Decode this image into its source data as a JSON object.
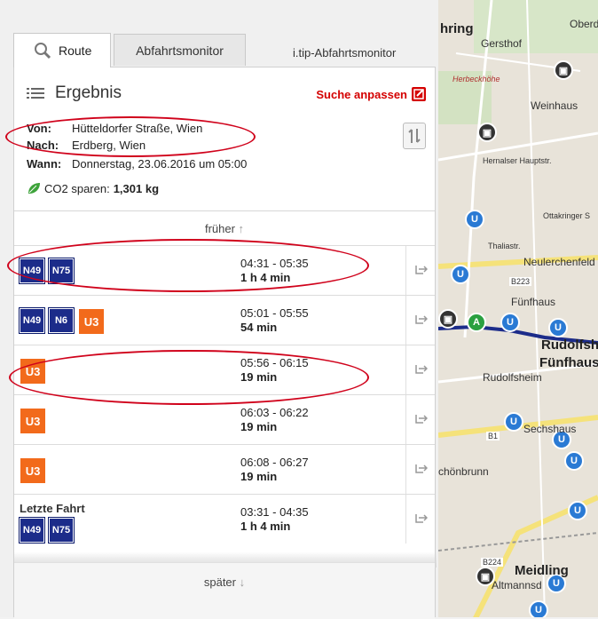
{
  "tabs": {
    "route": "Route",
    "monitor": "Abfahrtsmonitor",
    "itip": "i.tip-Abfahrtsmonitor"
  },
  "header": {
    "title": "Ergebnis",
    "edit_label": "Suche anpassen"
  },
  "trip": {
    "from_label": "Von:",
    "from_value": "Hütteldorfer Straße, Wien",
    "to_label": "Nach:",
    "to_value": "Erdberg, Wien",
    "when_label": "Wann:",
    "when_value": "Donnerstag, 23.06.2016 um 05:00",
    "co2_label": "CO2 sparen:",
    "co2_value": "1,301 kg"
  },
  "nav": {
    "earlier": "früher",
    "later": "später"
  },
  "connections": [
    {
      "lines": [
        "N49",
        "N75"
      ],
      "types": [
        "bus",
        "bus"
      ],
      "time": "04:31 - 05:35",
      "duration": "1 h 4 min"
    },
    {
      "lines": [
        "N49",
        "N6",
        "U3"
      ],
      "types": [
        "bus",
        "bus",
        "u"
      ],
      "time": "05:01 - 05:55",
      "duration": "54 min"
    },
    {
      "lines": [
        "U3"
      ],
      "types": [
        "u"
      ],
      "time": "05:56 - 06:15",
      "duration": "19 min"
    },
    {
      "lines": [
        "U3"
      ],
      "types": [
        "u"
      ],
      "time": "06:03 - 06:22",
      "duration": "19 min"
    },
    {
      "lines": [
        "U3"
      ],
      "types": [
        "u"
      ],
      "time": "06:08 - 06:27",
      "duration": "19 min"
    },
    {
      "lines": [
        "N49",
        "N75"
      ],
      "types": [
        "bus",
        "bus"
      ],
      "time": "03:31 - 04:35",
      "duration": "1 h 4 min",
      "note": "Letzte Fahrt"
    }
  ],
  "map": {
    "labels": [
      "hring",
      "Gersthof",
      "Oberd",
      "Herbeckhöhe",
      "Weinhaus",
      "Hernalser Hauptstr.",
      "Ottakringer S",
      "Thaliastr.",
      "Neulerchenfeld",
      "B223",
      "Fünfhaus",
      "Rudolfsh",
      "Fünfhaus",
      "Rudolfsheim",
      "Sechshaus",
      "B1",
      "chönbrunn",
      "B224",
      "Meidling",
      "Altmannsd"
    ],
    "colors": {
      "route": "#1c2c8a",
      "ubahn": "#2a7ad4",
      "road": "#f5e27a",
      "start": "#2aa040"
    }
  },
  "colors": {
    "accent": "#d40000",
    "bus": "#1c2c8a",
    "u3": "#f26a1b",
    "annotation": "#d0021b"
  }
}
